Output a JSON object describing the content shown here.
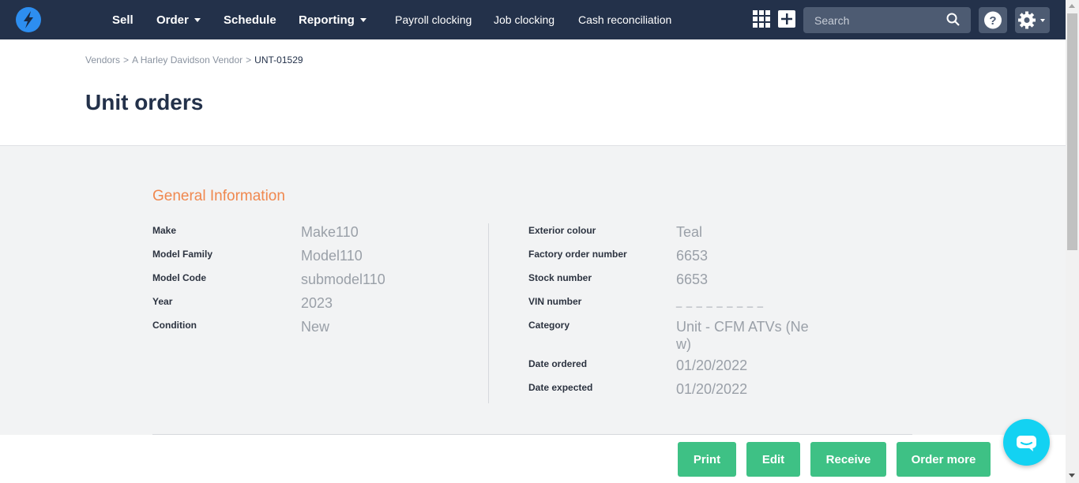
{
  "nav": {
    "logo": "lightning-logo",
    "items": [
      {
        "label": "Sell"
      },
      {
        "label": "Order"
      },
      {
        "label": "Schedule"
      },
      {
        "label": "Reporting"
      },
      {
        "label": "Payroll clocking"
      },
      {
        "label": "Job clocking"
      },
      {
        "label": "Cash reconciliation"
      }
    ],
    "search_placeholder": "Search",
    "icons": [
      "grid-icon",
      "plus-icon",
      "search-icon",
      "help-icon",
      "gear-icon"
    ]
  },
  "breadcrumb": [
    "Vendors",
    "A Harley Davidson Vendor",
    "UNT-01529"
  ],
  "page_title": "Unit orders",
  "general": {
    "title": "General Information",
    "left": [
      {
        "label": "Make",
        "value": "Make110"
      },
      {
        "label": "Model Family",
        "value": "Model110"
      },
      {
        "label": "Model Code",
        "value": "submodel110"
      },
      {
        "label": "Year",
        "value": "2023"
      },
      {
        "label": "Condition",
        "value": "New"
      }
    ],
    "right": [
      {
        "label": "Exterior colour",
        "value": "Teal"
      },
      {
        "label": "Factory order number",
        "value": "6653"
      },
      {
        "label": "Stock number",
        "value": "6653"
      },
      {
        "label": "VIN number",
        "value": "_ _ _ _ _ _ _ _ _"
      },
      {
        "label": "Category",
        "value": "Unit - CFM ATVs (Ne",
        "value2": "w)"
      },
      {
        "label": "Date ordered",
        "value": "01/20/2022"
      },
      {
        "label": "Date expected",
        "value": "01/20/2022"
      }
    ]
  },
  "actions": {
    "print": "Print",
    "edit": "Edit",
    "receive": "Receive",
    "order_more": "Order more"
  },
  "colors": {
    "nav_bg": "#23314a",
    "accent": "#f0884f",
    "button": "#3ec185",
    "chat": "#13d2f2"
  }
}
